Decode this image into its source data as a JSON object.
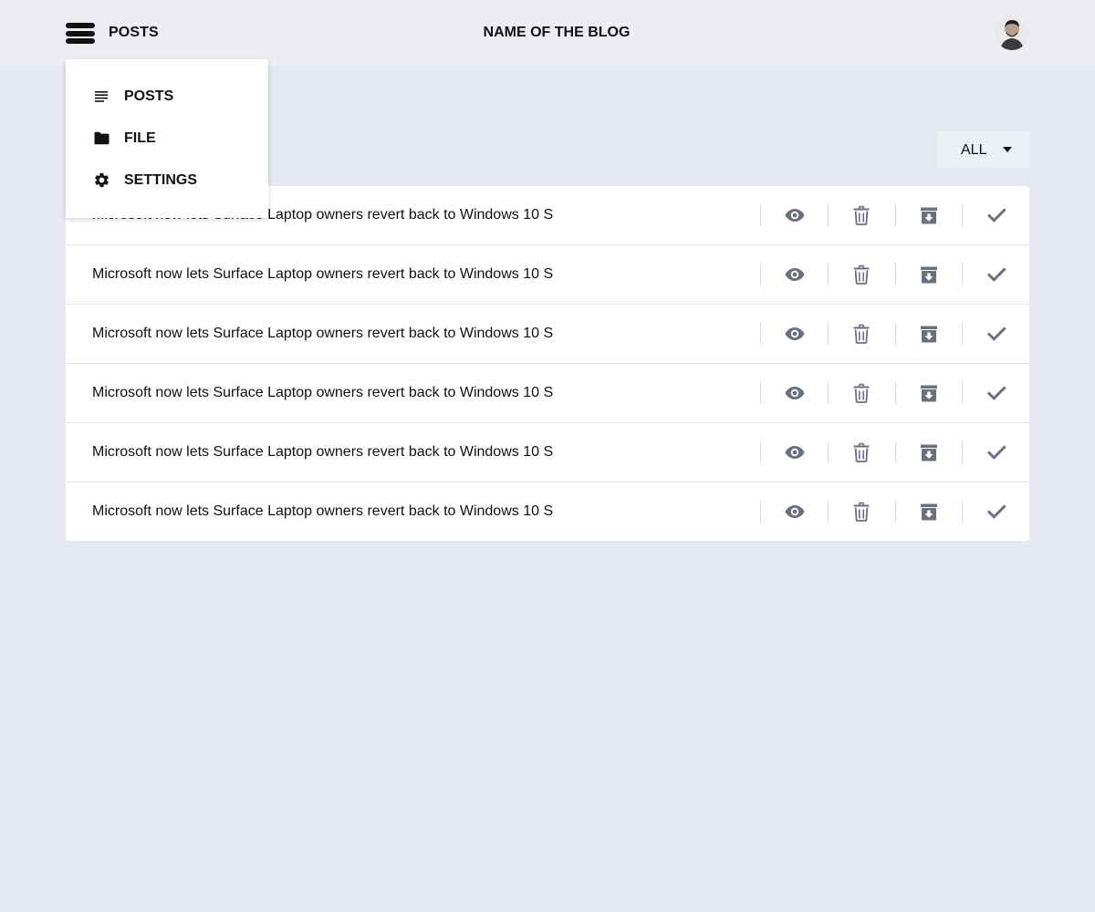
{
  "header": {
    "section_label": "POSTS",
    "blog_title": "NAME OF THE BLOG"
  },
  "menu": {
    "items": [
      {
        "label": "POSTS",
        "icon": "posts-lines-icon"
      },
      {
        "label": "FILE",
        "icon": "folder-icon"
      },
      {
        "label": "SETTINGS",
        "icon": "gear-icon"
      }
    ]
  },
  "filter": {
    "selected": "ALL"
  },
  "posts": [
    {
      "title": "Microsoft now lets Surface Laptop owners revert back to Windows 10 S"
    },
    {
      "title": "Microsoft now lets Surface Laptop owners revert back to Windows 10 S"
    },
    {
      "title": "Microsoft now lets Surface Laptop owners revert back to Windows 10 S"
    },
    {
      "title": "Microsoft now lets Surface Laptop owners revert back to Windows 10 S"
    },
    {
      "title": "Microsoft now lets Surface Laptop owners revert back to Windows 10 S"
    },
    {
      "title": "Microsoft now lets Surface Laptop owners revert back to Windows 10 S"
    }
  ],
  "row_actions": [
    "eye-icon",
    "trash-icon",
    "archive-icon",
    "check-icon"
  ],
  "colors": {
    "background": "#e5e8f0",
    "topbar": "#eceef3",
    "card": "#ffffff",
    "action_icon": "#6b7080",
    "text": "#111111"
  }
}
